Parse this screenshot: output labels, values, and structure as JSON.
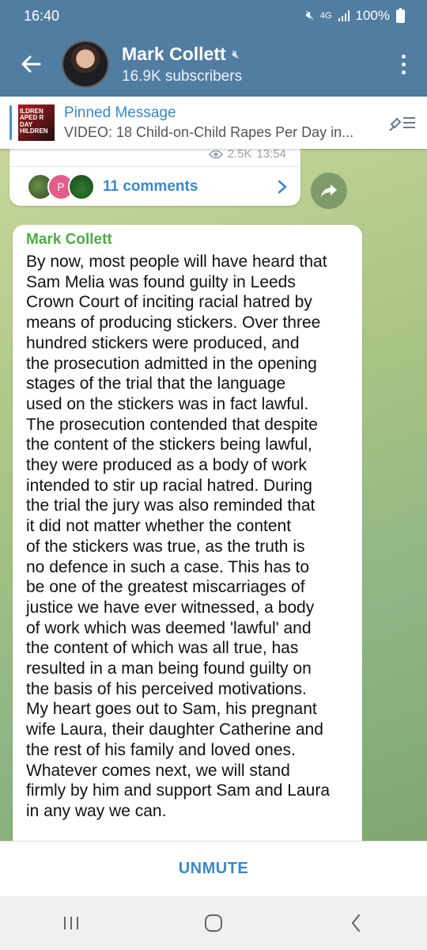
{
  "status_bar": {
    "time": "16:40",
    "network": "4G",
    "battery": "100%"
  },
  "header": {
    "channel_name": "Mark Collett",
    "subscribers": "16.9K subscribers",
    "back_icon": "back-arrow-icon",
    "menu_icon": "more-vert-icon"
  },
  "pinned": {
    "title": "Pinned Message",
    "text": "VIDEO: 18 Child-on-Child Rapes Per Day in...",
    "thumb_text": "ILDREN APED R DAY HILDREN"
  },
  "prev_message": {
    "views": "2.5K",
    "time": "13:54",
    "comments": "11 comments",
    "avatar_letter": "P"
  },
  "message": {
    "author": "Mark Collett",
    "text": "By now, most people will have heard that\nSam Melia was found guilty in Leeds\nCrown Court of inciting racial hatred by\nmeans of producing stickers. Over three\nhundred stickers were produced, and\nthe prosecution admitted in the opening\nstages of the trial that the language\nused on the stickers was in fact lawful.\nThe prosecution contended that despite\nthe content of the stickers being lawful,\nthey were produced as a body of work\nintended to stir up racial hatred. During\nthe trial the jury was also reminded that\nit did not matter whether the content\nof the stickers was true, as the truth is\nno defence in such a case. This has to\nbe one of the greatest miscarriages of\njustice we have ever witnessed, a body\nof work which was deemed 'lawful' and\nthe content of which was all true, has\nresulted in a man being found guilty on\nthe basis of his perceived motivations.\nMy heart goes out to Sam, his pregnant\nwife Laura, their daughter Catherine and\nthe rest of his family and loved ones.\nWhatever comes next, we will stand\nfirmly by him and support Sam and Laura\nin any way we can."
  },
  "footer": {
    "unmute_label": "UNMUTE"
  },
  "colors": {
    "header": "#517da2",
    "accent": "#3b87c9",
    "author": "#4fab42"
  }
}
